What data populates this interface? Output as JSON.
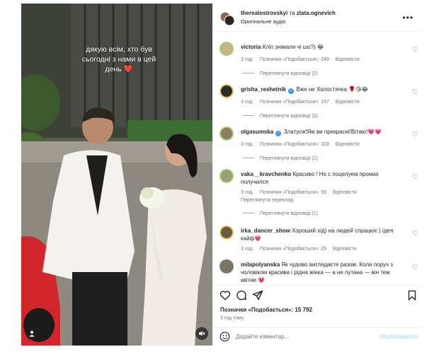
{
  "media": {
    "caption_lines": [
      "дякую всім, хто був",
      "сьогодні з нами в цей",
      "день ❤️"
    ]
  },
  "header": {
    "user1": "therealostrovskyi",
    "conjunction": "та",
    "user2": "zlata.ognevich",
    "audio": "Оригінальне аудіо",
    "more_icon": "more-horizontal-icon"
  },
  "comments": [
    {
      "user": "victoria",
      "verified": false,
      "text": "Кліп знімали чі шо?) 😂",
      "time": "3 год.",
      "likes": "Позначки «Подобається»: 249",
      "reply": "Відповісти",
      "view_replies": "Переглянути відповіді (2)",
      "avatar_color": "#c9b48a"
    },
    {
      "user": "grisha_reshetnik",
      "verified": true,
      "text": "Вже не Холостячка 🌹😘😂",
      "time": "3 год.",
      "likes": "Позначки «Подобається»: 197",
      "reply": "Відповісти",
      "view_replies": "Переглянути відповіді (2)",
      "avatar_color": "#2b2b2b"
    },
    {
      "user": "olgasumska",
      "verified": true,
      "text": "Златусік!Які ви прекрасні!Вітаю!💗💗",
      "time": "3 год.",
      "likes": "Позначки «Подобається»: 103",
      "reply": "Відповісти",
      "view_replies": "Переглянути відповіді (2)",
      "avatar_color": "#8f7a64"
    },
    {
      "user": "vaka__kravchenko",
      "verified": false,
      "text": "Красиво ! Но с поцелуем промах получился",
      "time": "3 год.",
      "likes": "Позначки «Подобається»: 59",
      "reply": "Відповісти",
      "translate": "Переглянути переклад",
      "view_replies": "Переглянути відповіді (1)",
      "avatar_color": "#9aa07a"
    },
    {
      "user": "irka_dancer_show",
      "verified": false,
      "text": "Хороший хід) на людей спрацює ) ідея кайф💗",
      "time": "3 год.",
      "likes": "Позначки «Подобається»: 29",
      "reply": "Відповісти",
      "avatar_color": "#6b5a3e"
    },
    {
      "user": "milapolyanska",
      "verified": false,
      "text": "Як чудово виглядаєте разом. Коли поруч з чоловіком красива і рідна жінка — а не путана — він теж квітне 💗",
      "avatar_color": "#7d7469"
    }
  ],
  "actions": {
    "like_icon": "heart-icon",
    "comment_icon": "comment-icon",
    "share_icon": "send-icon",
    "save_icon": "bookmark-icon",
    "likes_count": "Позначки «Подобається»: 15 792",
    "time_ago": "3 год тому"
  },
  "add_comment": {
    "emoji_icon": "emoji-icon",
    "placeholder": "Додайте коментар...",
    "post_label": "Опублікувати"
  },
  "colors": {
    "accent": "#0095f6",
    "post_disabled": "#b3dbff",
    "verified": "#3897f0",
    "heart": "#ff3040"
  }
}
